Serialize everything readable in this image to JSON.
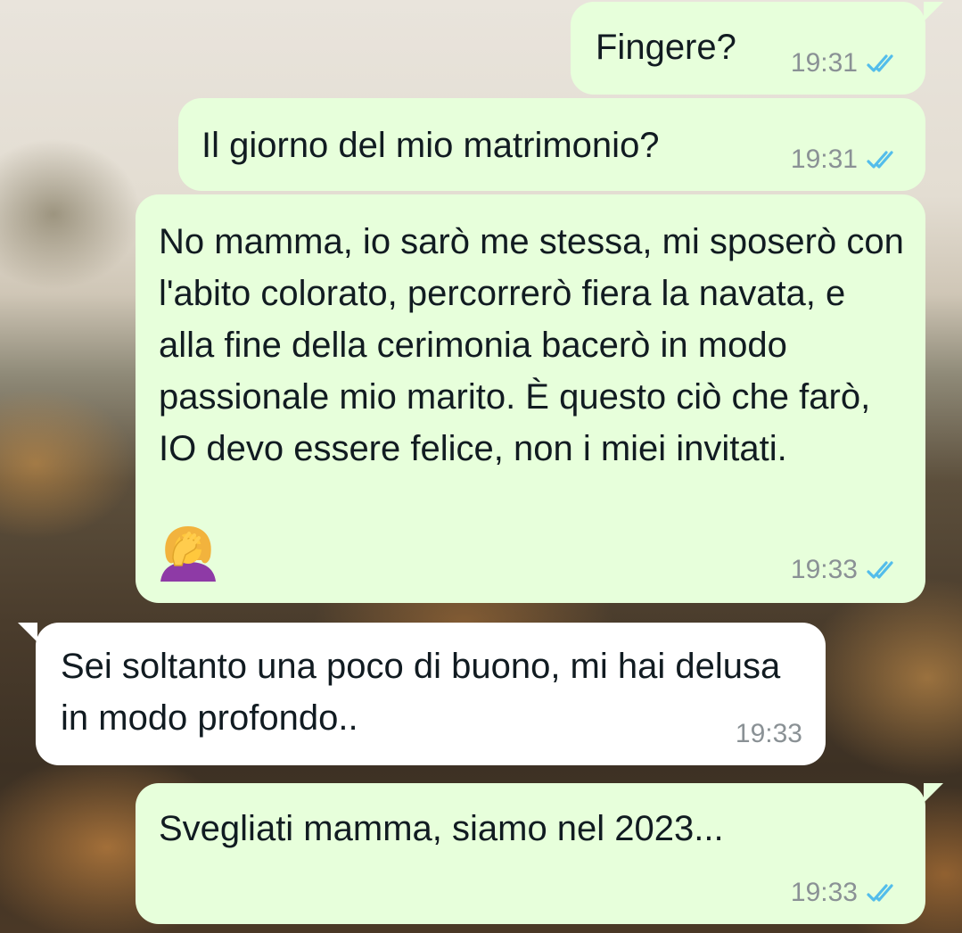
{
  "colors": {
    "outgoing_bubble": "#e7ffdb",
    "incoming_bubble": "#ffffff",
    "timestamp": "#8a9195",
    "read_ticks": "#53bdeb"
  },
  "messages": [
    {
      "direction": "outgoing",
      "text": "Fingere?",
      "time": "19:31",
      "status": "read"
    },
    {
      "direction": "outgoing",
      "text": "Il giorno del mio matrimonio?",
      "time": "19:31",
      "status": "read"
    },
    {
      "direction": "outgoing",
      "text": "No mamma, io sarò me stessa, mi sposerò con l'abito colorato, percorrerò fiera la navata, e alla fine della cerimonia bacerò in modo passionale mio marito. È questo ciò che farò, IO devo essere felice, non i miei invitati.",
      "emoji": "woman-facepalming",
      "time": "19:33",
      "status": "read"
    },
    {
      "direction": "incoming",
      "text": "Sei soltanto una poco di buono, mi hai delusa in modo profondo..",
      "time": "19:33"
    },
    {
      "direction": "outgoing",
      "text": "Svegliati mamma, siamo nel 2023...",
      "time": "19:33",
      "status": "read"
    }
  ]
}
